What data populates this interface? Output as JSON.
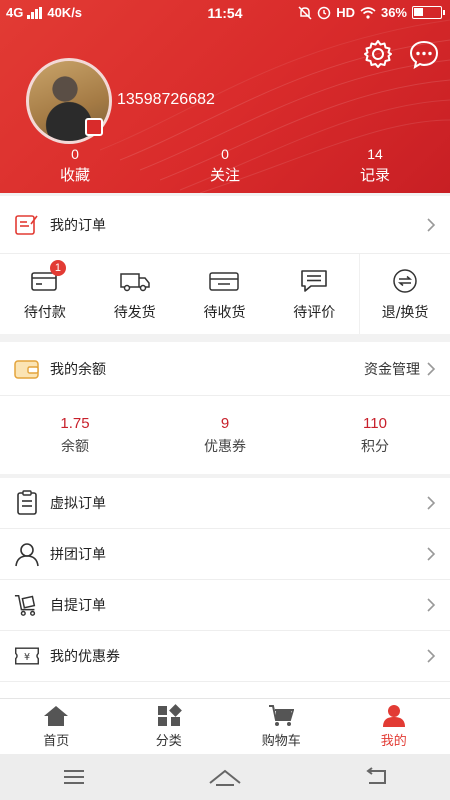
{
  "status_bar": {
    "network": "4G",
    "speed": "40K/s",
    "time": "11:54",
    "hd": "HD",
    "battery": "36%"
  },
  "header": {
    "settings_icon": "gear-icon",
    "message_icon": "chat-icon",
    "phone": "13598726682",
    "stats": [
      {
        "value": "0",
        "label": "收藏"
      },
      {
        "value": "0",
        "label": "关注"
      },
      {
        "value": "14",
        "label": "记录"
      }
    ]
  },
  "orders": {
    "title": "我的订单",
    "items": [
      {
        "label": "待付款",
        "icon": "wallet-icon",
        "badge": "1"
      },
      {
        "label": "待发货",
        "icon": "truck-icon"
      },
      {
        "label": "待收货",
        "icon": "box-icon"
      },
      {
        "label": "待评价",
        "icon": "comment-icon"
      },
      {
        "label": "退/换货",
        "icon": "exchange-icon"
      }
    ]
  },
  "balance": {
    "title": "我的余额",
    "manage_label": "资金管理",
    "items": [
      {
        "value": "1.75",
        "label": "余额"
      },
      {
        "value": "9",
        "label": "优惠券"
      },
      {
        "value": "110",
        "label": "积分"
      }
    ]
  },
  "menu": [
    {
      "label": "虚拟订单",
      "icon": "clipboard-icon"
    },
    {
      "label": "拼团订单",
      "icon": "user-icon"
    },
    {
      "label": "自提订单",
      "icon": "cart-pickup-icon"
    },
    {
      "label": "我的优惠券",
      "icon": "coupon-icon"
    }
  ],
  "tabbar": [
    {
      "label": "首页",
      "icon": "home-icon"
    },
    {
      "label": "分类",
      "icon": "category-icon"
    },
    {
      "label": "购物车",
      "icon": "cart-icon"
    },
    {
      "label": "我的",
      "icon": "profile-icon",
      "active": true
    }
  ],
  "colors": {
    "brand": "#e23b34",
    "value": "#c8202b"
  }
}
